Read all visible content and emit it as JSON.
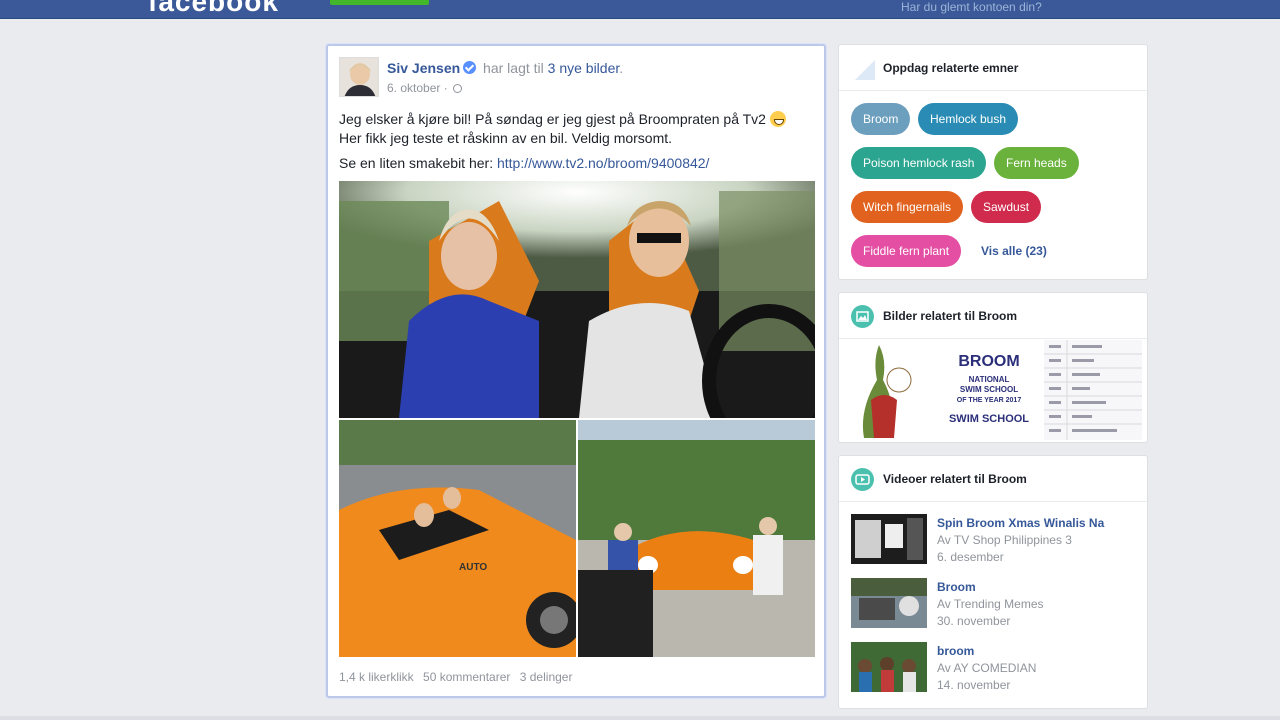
{
  "header": {
    "logo": "facebook",
    "forgot_account": "Har du glemt kontoen din?"
  },
  "post": {
    "author": "Siv Jensen",
    "action": "har lagt til",
    "photos_link": "3 nye bilder",
    "date": "6. oktober ·",
    "text_line1": "Jeg elsker å kjøre bil! På søndag er jeg gjest på Broompraten på Tv2",
    "text_line2": "Her fikk jeg teste et råskinn av en bil. Veldig morsomt.",
    "preview_prefix": "Se en liten smakebit her:",
    "preview_link": "http://www.tv2.no/broom/9400842/",
    "stats": {
      "likes": "1,4 k likerklikk",
      "comments": "50 kommentarer",
      "shares": "3 delinger"
    }
  },
  "sidebar": {
    "topics": {
      "title": "Oppdag relaterte emner",
      "items": [
        {
          "label": "Broom",
          "color": "#6c9fbd"
        },
        {
          "label": "Hemlock bush",
          "color": "#2a8cb4"
        },
        {
          "label": "Poison hemlock rash",
          "color": "#2ba58f"
        },
        {
          "label": "Fern heads",
          "color": "#6ab23b"
        },
        {
          "label": "Witch fingernails",
          "color": "#e1621e"
        },
        {
          "label": "Sawdust",
          "color": "#d02a4c"
        },
        {
          "label": "Fiddle fern plant",
          "color": "#e44fa3"
        }
      ],
      "see_all": "Vis alle (23)"
    },
    "images": {
      "title": "Bilder relatert til Broom",
      "logo_line1": "BROOM",
      "logo_line2": "NATIONAL",
      "logo_line3": "SWIM SCHOOL",
      "logo_line4": "OF THE YEAR 2017",
      "logo_line5": "SWIM SCHOOL"
    },
    "videos": {
      "title": "Videoer relatert til Broom",
      "items": [
        {
          "title": "Spin Broom Xmas Winalis Na",
          "by": "Av TV Shop Philippines 3",
          "date": "6. desember"
        },
        {
          "title": "Broom",
          "by": "Av Trending Memes",
          "date": "30. november"
        },
        {
          "title": "broom",
          "by": "Av AY COMEDIAN",
          "date": "14. november"
        }
      ]
    }
  }
}
